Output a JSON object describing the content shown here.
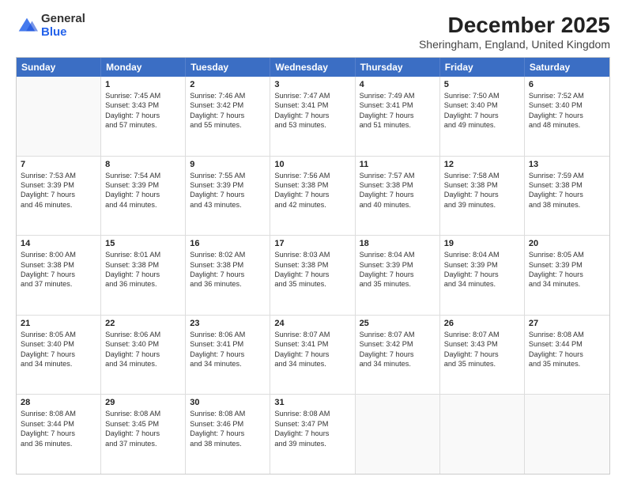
{
  "logo": {
    "general": "General",
    "blue": "Blue"
  },
  "header": {
    "month": "December 2025",
    "location": "Sheringham, England, United Kingdom"
  },
  "days": [
    "Sunday",
    "Monday",
    "Tuesday",
    "Wednesday",
    "Thursday",
    "Friday",
    "Saturday"
  ],
  "weeks": [
    [
      {
        "day": "",
        "sunrise": "",
        "sunset": "",
        "daylight": ""
      },
      {
        "day": "1",
        "sunrise": "Sunrise: 7:45 AM",
        "sunset": "Sunset: 3:43 PM",
        "daylight": "Daylight: 7 hours",
        "daylight2": "and 57 minutes."
      },
      {
        "day": "2",
        "sunrise": "Sunrise: 7:46 AM",
        "sunset": "Sunset: 3:42 PM",
        "daylight": "Daylight: 7 hours",
        "daylight2": "and 55 minutes."
      },
      {
        "day": "3",
        "sunrise": "Sunrise: 7:47 AM",
        "sunset": "Sunset: 3:41 PM",
        "daylight": "Daylight: 7 hours",
        "daylight2": "and 53 minutes."
      },
      {
        "day": "4",
        "sunrise": "Sunrise: 7:49 AM",
        "sunset": "Sunset: 3:41 PM",
        "daylight": "Daylight: 7 hours",
        "daylight2": "and 51 minutes."
      },
      {
        "day": "5",
        "sunrise": "Sunrise: 7:50 AM",
        "sunset": "Sunset: 3:40 PM",
        "daylight": "Daylight: 7 hours",
        "daylight2": "and 49 minutes."
      },
      {
        "day": "6",
        "sunrise": "Sunrise: 7:52 AM",
        "sunset": "Sunset: 3:40 PM",
        "daylight": "Daylight: 7 hours",
        "daylight2": "and 48 minutes."
      }
    ],
    [
      {
        "day": "7",
        "sunrise": "Sunrise: 7:53 AM",
        "sunset": "Sunset: 3:39 PM",
        "daylight": "Daylight: 7 hours",
        "daylight2": "and 46 minutes."
      },
      {
        "day": "8",
        "sunrise": "Sunrise: 7:54 AM",
        "sunset": "Sunset: 3:39 PM",
        "daylight": "Daylight: 7 hours",
        "daylight2": "and 44 minutes."
      },
      {
        "day": "9",
        "sunrise": "Sunrise: 7:55 AM",
        "sunset": "Sunset: 3:39 PM",
        "daylight": "Daylight: 7 hours",
        "daylight2": "and 43 minutes."
      },
      {
        "day": "10",
        "sunrise": "Sunrise: 7:56 AM",
        "sunset": "Sunset: 3:38 PM",
        "daylight": "Daylight: 7 hours",
        "daylight2": "and 42 minutes."
      },
      {
        "day": "11",
        "sunrise": "Sunrise: 7:57 AM",
        "sunset": "Sunset: 3:38 PM",
        "daylight": "Daylight: 7 hours",
        "daylight2": "and 40 minutes."
      },
      {
        "day": "12",
        "sunrise": "Sunrise: 7:58 AM",
        "sunset": "Sunset: 3:38 PM",
        "daylight": "Daylight: 7 hours",
        "daylight2": "and 39 minutes."
      },
      {
        "day": "13",
        "sunrise": "Sunrise: 7:59 AM",
        "sunset": "Sunset: 3:38 PM",
        "daylight": "Daylight: 7 hours",
        "daylight2": "and 38 minutes."
      }
    ],
    [
      {
        "day": "14",
        "sunrise": "Sunrise: 8:00 AM",
        "sunset": "Sunset: 3:38 PM",
        "daylight": "Daylight: 7 hours",
        "daylight2": "and 37 minutes."
      },
      {
        "day": "15",
        "sunrise": "Sunrise: 8:01 AM",
        "sunset": "Sunset: 3:38 PM",
        "daylight": "Daylight: 7 hours",
        "daylight2": "and 36 minutes."
      },
      {
        "day": "16",
        "sunrise": "Sunrise: 8:02 AM",
        "sunset": "Sunset: 3:38 PM",
        "daylight": "Daylight: 7 hours",
        "daylight2": "and 36 minutes."
      },
      {
        "day": "17",
        "sunrise": "Sunrise: 8:03 AM",
        "sunset": "Sunset: 3:38 PM",
        "daylight": "Daylight: 7 hours",
        "daylight2": "and 35 minutes."
      },
      {
        "day": "18",
        "sunrise": "Sunrise: 8:04 AM",
        "sunset": "Sunset: 3:39 PM",
        "daylight": "Daylight: 7 hours",
        "daylight2": "and 35 minutes."
      },
      {
        "day": "19",
        "sunrise": "Sunrise: 8:04 AM",
        "sunset": "Sunset: 3:39 PM",
        "daylight": "Daylight: 7 hours",
        "daylight2": "and 34 minutes."
      },
      {
        "day": "20",
        "sunrise": "Sunrise: 8:05 AM",
        "sunset": "Sunset: 3:39 PM",
        "daylight": "Daylight: 7 hours",
        "daylight2": "and 34 minutes."
      }
    ],
    [
      {
        "day": "21",
        "sunrise": "Sunrise: 8:05 AM",
        "sunset": "Sunset: 3:40 PM",
        "daylight": "Daylight: 7 hours",
        "daylight2": "and 34 minutes."
      },
      {
        "day": "22",
        "sunrise": "Sunrise: 8:06 AM",
        "sunset": "Sunset: 3:40 PM",
        "daylight": "Daylight: 7 hours",
        "daylight2": "and 34 minutes."
      },
      {
        "day": "23",
        "sunrise": "Sunrise: 8:06 AM",
        "sunset": "Sunset: 3:41 PM",
        "daylight": "Daylight: 7 hours",
        "daylight2": "and 34 minutes."
      },
      {
        "day": "24",
        "sunrise": "Sunrise: 8:07 AM",
        "sunset": "Sunset: 3:41 PM",
        "daylight": "Daylight: 7 hours",
        "daylight2": "and 34 minutes."
      },
      {
        "day": "25",
        "sunrise": "Sunrise: 8:07 AM",
        "sunset": "Sunset: 3:42 PM",
        "daylight": "Daylight: 7 hours",
        "daylight2": "and 34 minutes."
      },
      {
        "day": "26",
        "sunrise": "Sunrise: 8:07 AM",
        "sunset": "Sunset: 3:43 PM",
        "daylight": "Daylight: 7 hours",
        "daylight2": "and 35 minutes."
      },
      {
        "day": "27",
        "sunrise": "Sunrise: 8:08 AM",
        "sunset": "Sunset: 3:44 PM",
        "daylight": "Daylight: 7 hours",
        "daylight2": "and 35 minutes."
      }
    ],
    [
      {
        "day": "28",
        "sunrise": "Sunrise: 8:08 AM",
        "sunset": "Sunset: 3:44 PM",
        "daylight": "Daylight: 7 hours",
        "daylight2": "and 36 minutes."
      },
      {
        "day": "29",
        "sunrise": "Sunrise: 8:08 AM",
        "sunset": "Sunset: 3:45 PM",
        "daylight": "Daylight: 7 hours",
        "daylight2": "and 37 minutes."
      },
      {
        "day": "30",
        "sunrise": "Sunrise: 8:08 AM",
        "sunset": "Sunset: 3:46 PM",
        "daylight": "Daylight: 7 hours",
        "daylight2": "and 38 minutes."
      },
      {
        "day": "31",
        "sunrise": "Sunrise: 8:08 AM",
        "sunset": "Sunset: 3:47 PM",
        "daylight": "Daylight: 7 hours",
        "daylight2": "and 39 minutes."
      },
      {
        "day": "",
        "sunrise": "",
        "sunset": "",
        "daylight": ""
      },
      {
        "day": "",
        "sunrise": "",
        "sunset": "",
        "daylight": ""
      },
      {
        "day": "",
        "sunrise": "",
        "sunset": "",
        "daylight": ""
      }
    ]
  ]
}
